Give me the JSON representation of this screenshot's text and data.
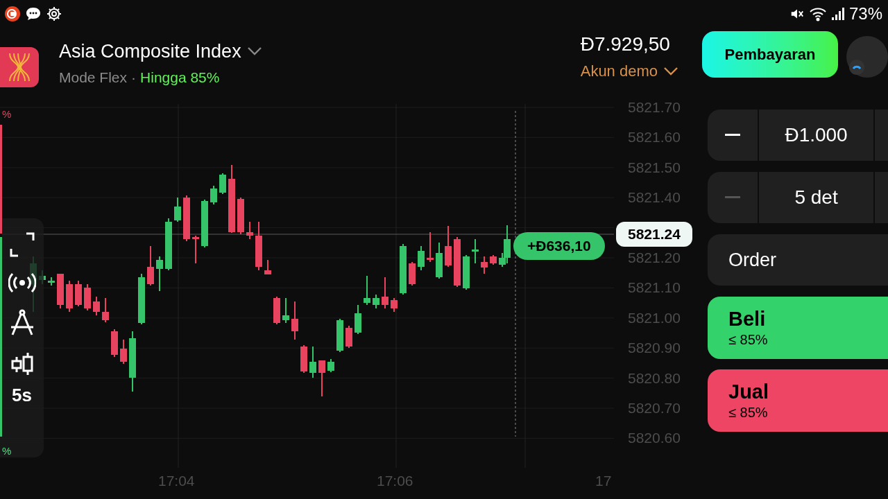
{
  "status_bar": {
    "battery": "73%"
  },
  "header": {
    "instrument": "Asia Composite Index",
    "mode": "Mode Flex",
    "separator": "·",
    "payout": "Hingga 85%",
    "balance": "Đ7.929,50",
    "account": "Akun demo",
    "payment_button": "Pembayaran"
  },
  "chart": {
    "y_labels": [
      "5821.70",
      "5821.60",
      "5821.50",
      "5821.40",
      "5821.20",
      "5821.10",
      "5821.00",
      "5820.90",
      "5820.80",
      "5820.70",
      "5820.60"
    ],
    "x_labels": [
      "17:04",
      "17:06",
      "17"
    ],
    "current_price": "5821.24",
    "profit": "+Đ636,10",
    "sentiment": {
      "level": 0.36,
      "top_label": "%",
      "bottom_label": "%"
    }
  },
  "toolbar": {
    "interval": "5s"
  },
  "trade": {
    "amount": "Đ1.000",
    "duration": "5 det",
    "duration_minus_disabled": true,
    "order_label": "Order",
    "actions": [
      {
        "kind": "buy",
        "label": "Beli",
        "payout": "≤ 85%"
      },
      {
        "kind": "sell",
        "label": "Jual",
        "payout": "≤ 85%"
      }
    ]
  }
}
